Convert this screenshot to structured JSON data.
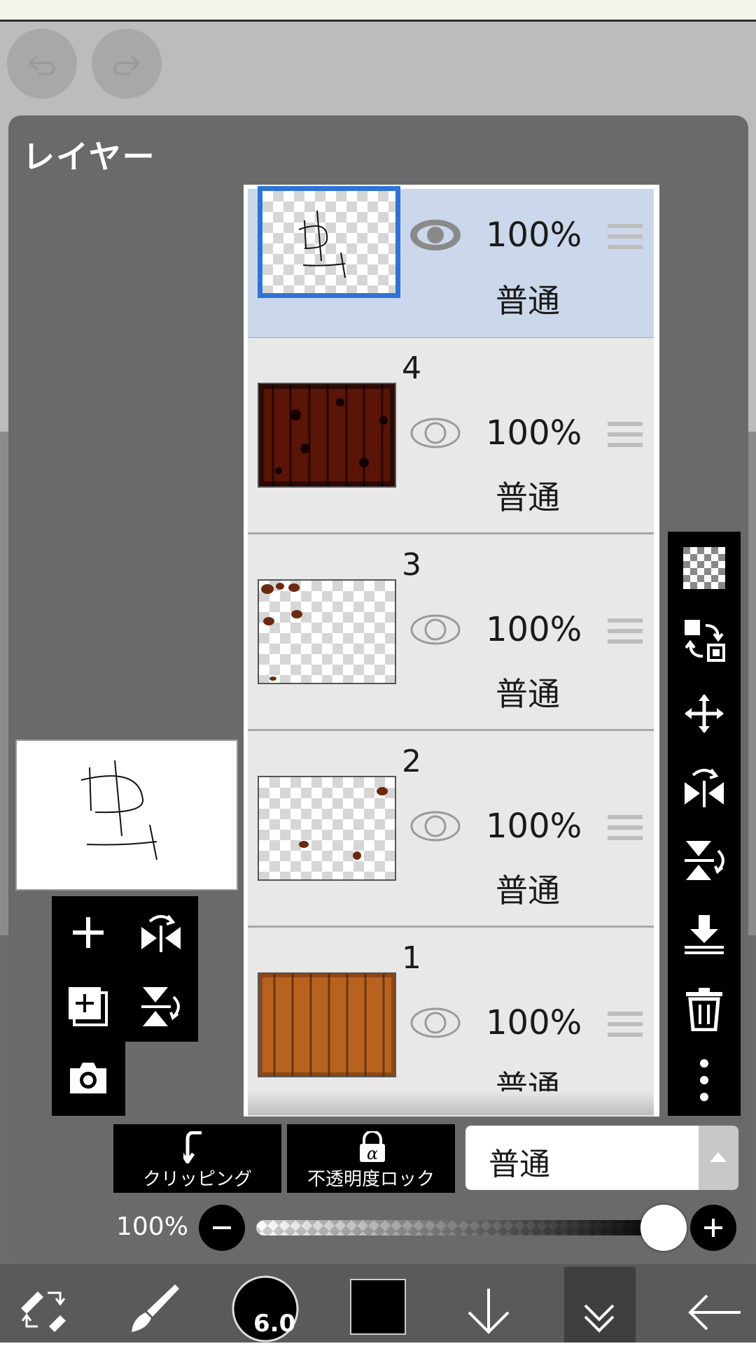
{
  "panel": {
    "title": "レイヤー"
  },
  "layers": [
    {
      "name": "",
      "opacity": "100%",
      "blend": "普通",
      "visible": true,
      "selected": true
    },
    {
      "name": "4",
      "opacity": "100%",
      "blend": "普通",
      "visible": true,
      "selected": false
    },
    {
      "name": "3",
      "opacity": "100%",
      "blend": "普通",
      "visible": true,
      "selected": false
    },
    {
      "name": "2",
      "opacity": "100%",
      "blend": "普通",
      "visible": true,
      "selected": false
    },
    {
      "name": "1",
      "opacity": "100%",
      "blend": "普通",
      "visible": true,
      "selected": false
    }
  ],
  "actions": {
    "clipping_label": "クリッピング",
    "alpha_lock_label": "不透明度ロック",
    "blend_mode_value": "普通"
  },
  "opacity_slider": {
    "label": "100%",
    "value": 1.0
  },
  "bottom_nav": {
    "brush_size": "6.0",
    "color": "#000000"
  },
  "colors": {
    "accent": "#2f73d6",
    "panel": "#6a6a6a",
    "selected_row": "#cbd7ea"
  },
  "icons": {
    "undo": "undo-icon",
    "redo": "redo-icon",
    "right_toolbar": [
      "transparency-icon",
      "swap-icon",
      "move-icon",
      "flip-horizontal-icon",
      "flip-vertical-icon",
      "merge-down-icon",
      "trash-icon",
      "more-vertical-icon"
    ],
    "left_toolbar": [
      "add-layer-icon",
      "flip-h-icon",
      "add-copy-icon",
      "flip-v-icon",
      "camera-icon"
    ]
  }
}
